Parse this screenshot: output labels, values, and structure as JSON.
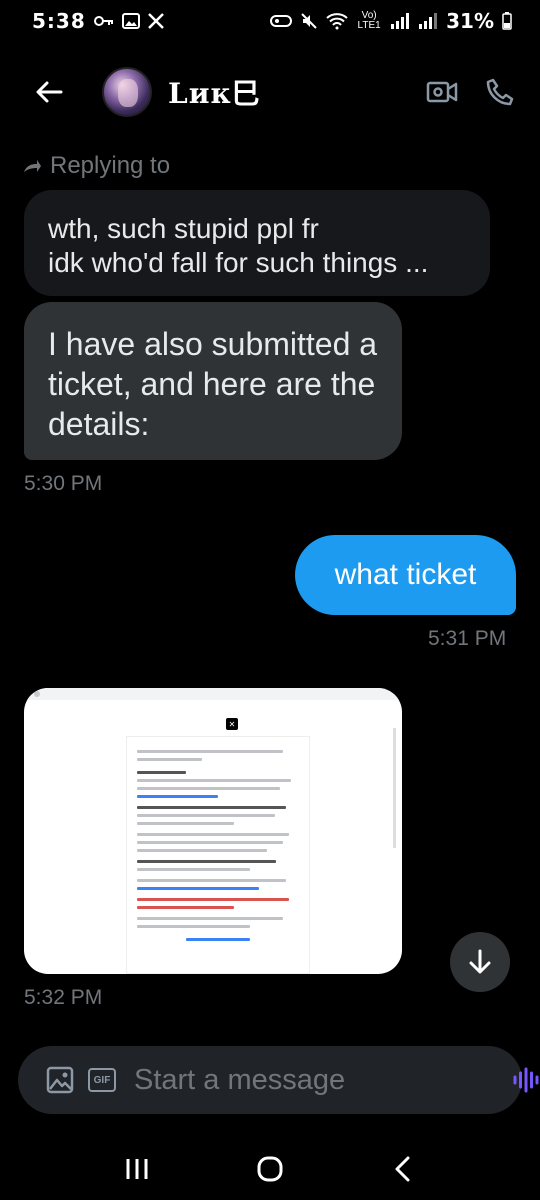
{
  "status_bar": {
    "time": "5:38",
    "network_label": "Vo) LTE1",
    "battery": "31%"
  },
  "header": {
    "contact_name": "Lик巳"
  },
  "thread": {
    "replying_label": "Replying to",
    "quoted_line_1": "wth, such stupid ppl fr",
    "quoted_line_2": "idk who'd fall for such things ...",
    "received_message": "I have also submitted a ticket, and here are the details:",
    "received_time": "5:30 PM",
    "sent_message": "what ticket",
    "sent_time": "5:31 PM",
    "image_time": "5:32 PM"
  },
  "composer": {
    "placeholder": "Start a message"
  },
  "colors": {
    "sent_bubble": "#1d9bf0",
    "received_bubble": "#2f3336",
    "voice_accent": "#7856ff"
  }
}
